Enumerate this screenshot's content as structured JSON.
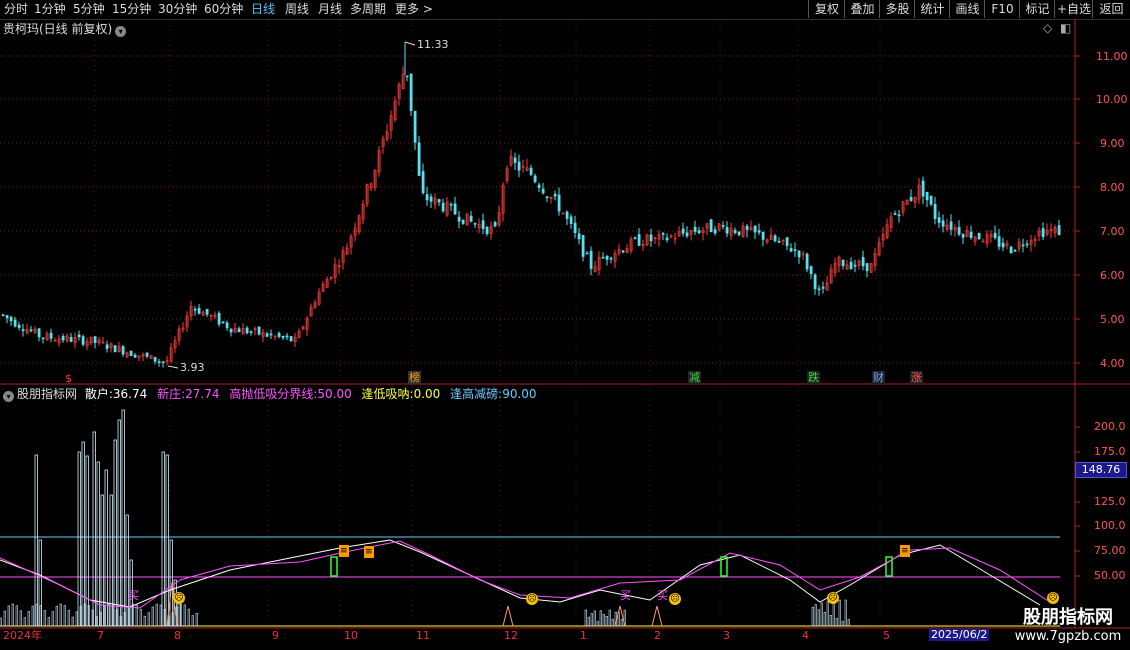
{
  "toolbar": {
    "timeframes": [
      "分时",
      "1分钟",
      "5分钟",
      "15分钟",
      "30分钟",
      "60分钟",
      "日线",
      "周线",
      "月线",
      "多周期",
      "更多 >"
    ],
    "active": "日线",
    "right_buttons": [
      "复权",
      "叠加",
      "多股",
      "统计",
      "画线",
      "F10",
      "标记",
      "+自选",
      "返回"
    ]
  },
  "stock": {
    "title": "贵柯玛(日线 前复权)",
    "high_label": "11.33",
    "low_label": "3.93"
  },
  "main_axis": {
    "ticks": [
      "11.00",
      "10.00",
      "9.00",
      "8.00",
      "7.00",
      "6.00",
      "5.00",
      "4.00"
    ]
  },
  "events": [
    "榜",
    "减",
    "跌",
    "财",
    "涨"
  ],
  "event_first": "$",
  "indicator": {
    "name": "股朋指标网",
    "items": [
      {
        "label": "散户:",
        "value": "36.74",
        "color": "#ffffff"
      },
      {
        "label": "新庄:",
        "value": "27.74",
        "color": "#ff55ff"
      },
      {
        "label": "高抛低吸分界线:",
        "value": "50.00",
        "color": "#ff55ff"
      },
      {
        "label": "逢低吸呐:",
        "value": "0.00",
        "color": "#ffff44"
      },
      {
        "label": "逢高减磅:",
        "value": "90.00",
        "color": "#66ccff"
      }
    ],
    "ticks": [
      "200.0",
      "175.0",
      "150.0",
      "125.0",
      "100.0",
      "75.00",
      "50.00"
    ],
    "current": "148.76",
    "buy_label": "买"
  },
  "xaxis": {
    "labels": [
      "2024年",
      "7",
      "8",
      "9",
      "10",
      "11",
      "12",
      "1",
      "2",
      "3",
      "4",
      "5"
    ],
    "date_box": "2025/06/2"
  },
  "watermark": {
    "title": "股朋指标网",
    "url": "www.7gpzb.com"
  },
  "colors": {
    "up": "#ff3b3b",
    "down": "#58e0f0",
    "axis": "#b22222",
    "magenta": "#ff55ff",
    "cyan": "#66ccff"
  }
}
